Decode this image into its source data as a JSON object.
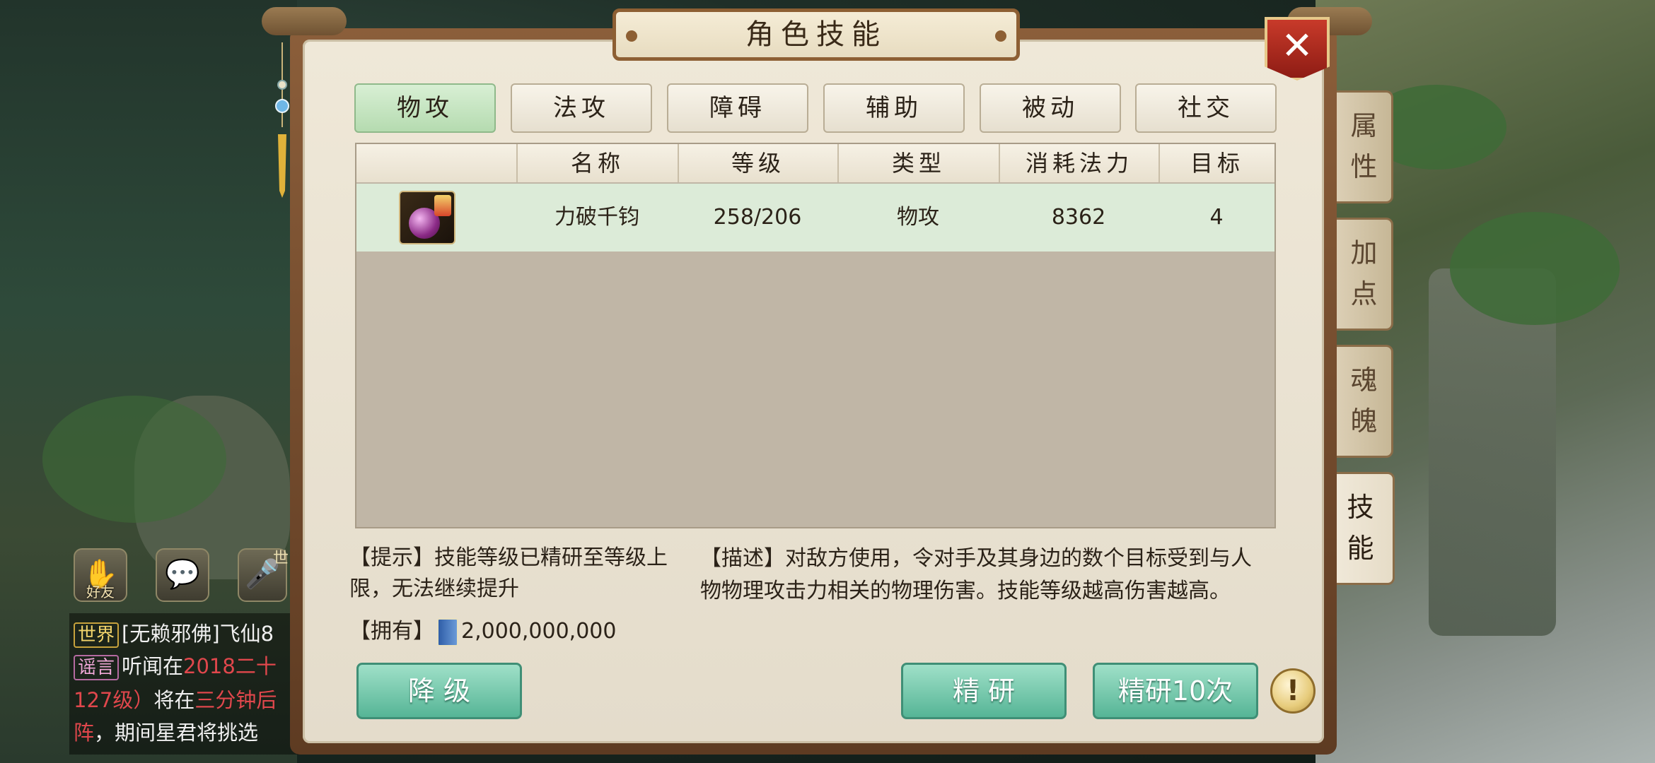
{
  "window": {
    "title": "角色技能",
    "close_label": "✕"
  },
  "category_tabs": [
    {
      "label": "物攻",
      "active": true
    },
    {
      "label": "法攻",
      "active": false
    },
    {
      "label": "障碍",
      "active": false
    },
    {
      "label": "辅助",
      "active": false
    },
    {
      "label": "被动",
      "active": false
    },
    {
      "label": "社交",
      "active": false
    }
  ],
  "table": {
    "columns": [
      "",
      "名称",
      "等级",
      "类型",
      "消耗法力",
      "目标"
    ],
    "rows": [
      {
        "name": "力破千钧",
        "level": "258/206",
        "type": "物攻",
        "mana": "8362",
        "target": "4"
      }
    ]
  },
  "side_tabs": [
    {
      "label": [
        "属",
        "性"
      ],
      "active": false
    },
    {
      "label": [
        "加",
        "点"
      ],
      "active": false
    },
    {
      "label": [
        "魂",
        "魄"
      ],
      "active": false
    },
    {
      "label": [
        "技",
        "能"
      ],
      "active": true
    }
  ],
  "tip": "【提示】技能等级已精研至等级上限，无法继续提升",
  "description": "【描述】对敌方使用，令对手及其身边的数个目标受到与人物物理攻击力相关的物理伤害。技能等级越高伤害越高。",
  "own": {
    "prefix": "【拥有】",
    "amount": "2,000,000,000"
  },
  "buttons": {
    "downgrade": "降 级",
    "refine": "精 研",
    "refine10": "精研10次",
    "hint": "!"
  },
  "social": {
    "friends_label": "好友",
    "world_cut": "世"
  },
  "chat": {
    "line1_tag": "世界",
    "line1_text": "[无赖邪佛]飞仙8",
    "line2_tag": "谣言",
    "line2_text": "听闻在",
    "line2_red": "2018二十",
    "line3_red1": "127级）",
    "line3_text": "将在",
    "line3_red2": "三分钟后",
    "line4_red": "阵",
    "line4_text": "，期间星君将挑选"
  },
  "colors": {
    "accent_green": "#56b596",
    "frame_brown": "#8b5e3a",
    "close_red": "#c83a2a",
    "chat_red": "#e0474c"
  }
}
